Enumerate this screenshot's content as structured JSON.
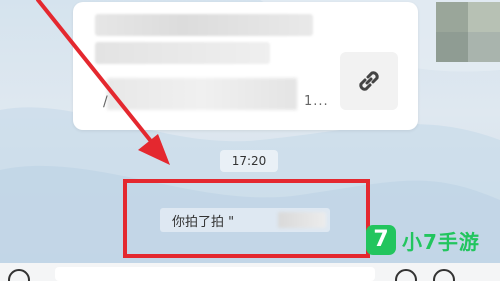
{
  "chat": {
    "link_card": {
      "title_blurred": "",
      "desc_prefix": "/",
      "desc_suffix": "1...",
      "link_icon": "link-icon"
    },
    "timestamp": "17:20",
    "pat_message": "你拍了拍 \"",
    "pat_target_blurred": "",
    "highlight_color": "#e4282f"
  },
  "watermark": {
    "badge": "7",
    "text": "小7手游",
    "color": "#22c55e"
  },
  "bottom_bar": {
    "left_icon": "voice-icon",
    "right_icons": [
      "emoji-icon",
      "add-icon"
    ]
  }
}
